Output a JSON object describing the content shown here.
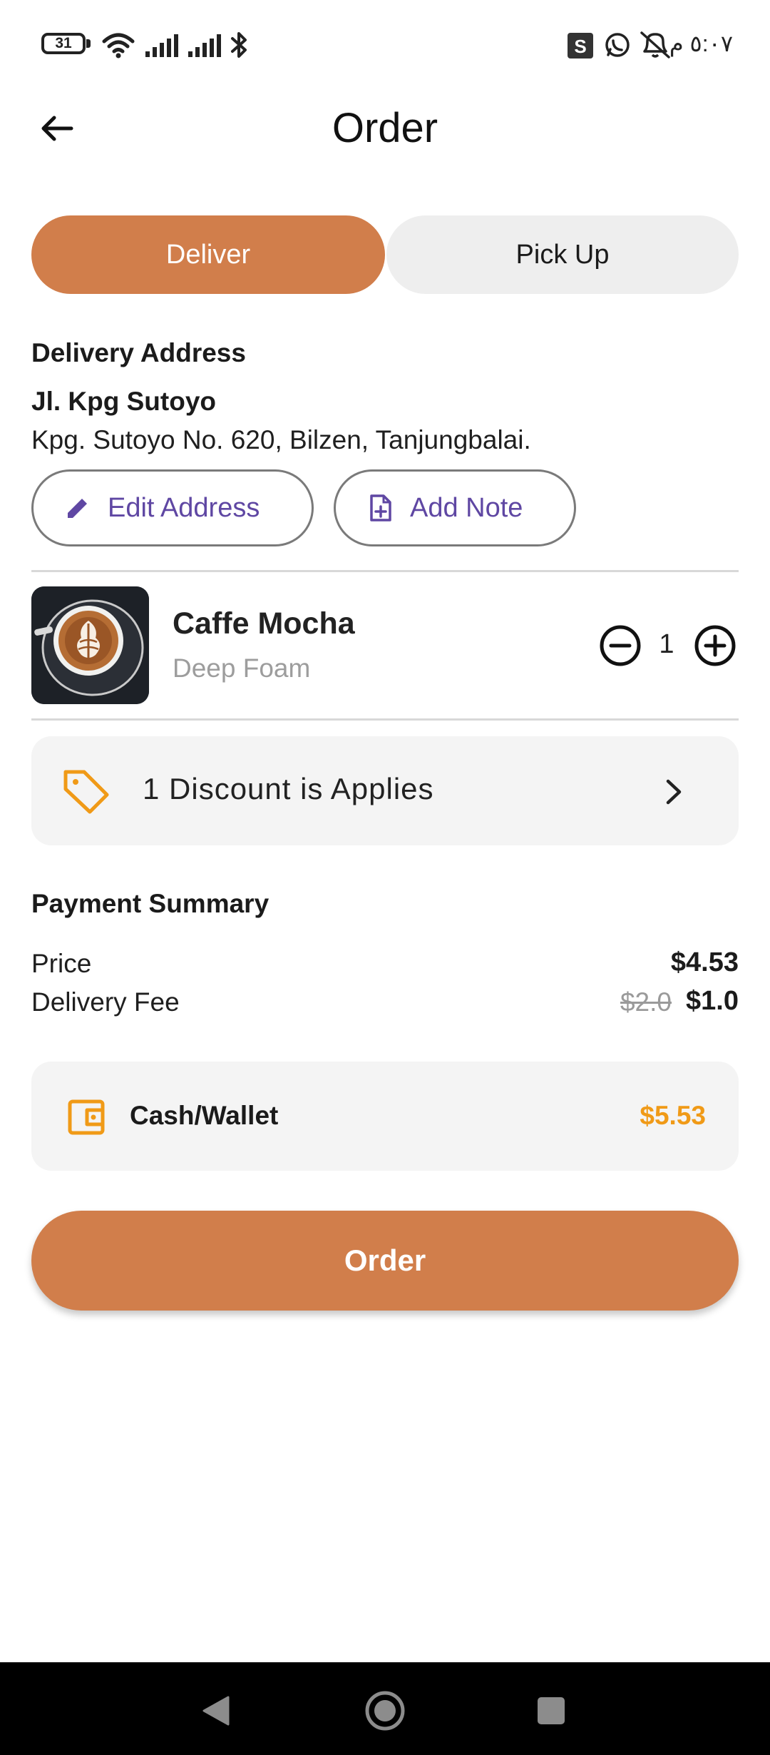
{
  "status_bar": {
    "battery": "31",
    "time": "٥:٠٧ م"
  },
  "header": {
    "title": "Order"
  },
  "mode_tabs": {
    "deliver": "Deliver",
    "pickup": "Pick Up",
    "selected": "Deliver"
  },
  "address": {
    "section_title": "Delivery Address",
    "street": "Jl. Kpg Sutoyo",
    "full": "Kpg. Sutoyo No. 620, Bilzen, Tanjungbalai.",
    "edit_label": "Edit Address",
    "note_label": "Add Note"
  },
  "item": {
    "name": "Caffe Mocha",
    "variant": "Deep Foam",
    "quantity": "1"
  },
  "discount": {
    "text": "1 Discount is Applies"
  },
  "payment_summary": {
    "title": "Payment Summary",
    "price_label": "Price",
    "price_value": "$4.53",
    "fee_label": "Delivery Fee",
    "fee_old": "$2.0",
    "fee_value": "$1.0"
  },
  "payment_method": {
    "label": "Cash/Wallet",
    "amount": "$5.53"
  },
  "order_button": "Order",
  "colors": {
    "accent": "#D17E4B",
    "link_purple": "#5F47A3",
    "amount_orange": "#F09A17"
  }
}
